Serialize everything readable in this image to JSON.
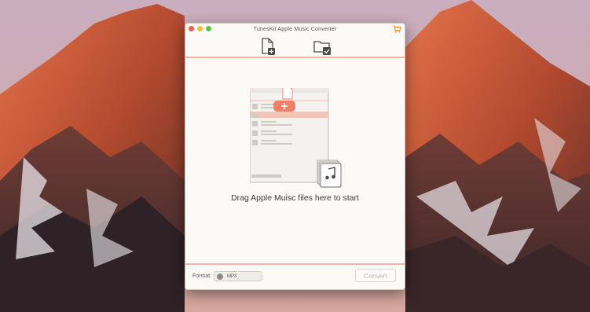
{
  "window": {
    "title": "TunesKit Apple Music Converter"
  },
  "toolbar": {
    "add_files_icon": "add-file-icon",
    "history_icon": "converted-folder-icon"
  },
  "dropzone": {
    "instruction": "Drag Apple Muisc files here to start"
  },
  "bottombar": {
    "format_label": "Format:",
    "format_value": "MP3",
    "convert_label": "Convert"
  },
  "colors": {
    "accent": "#f2b3a4",
    "close": "#ec5f56",
    "minimize": "#f1be3a",
    "zoom": "#5fc249",
    "cart": "#f07e2a"
  }
}
